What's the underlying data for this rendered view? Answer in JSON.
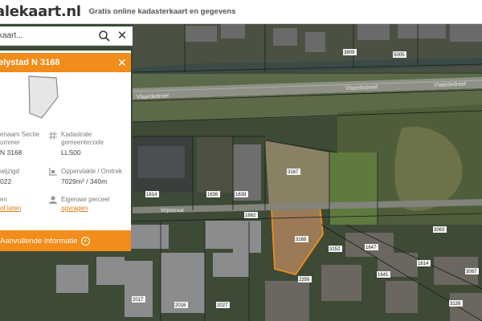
{
  "header": {
    "logo": "alekaart.nl",
    "tagline": "Gratis online kadasterkaart en gegevens"
  },
  "search": {
    "placeholder": "kaart..."
  },
  "panel": {
    "title": "elystad N 3168",
    "fields": {
      "section_label": "enaam Sectie\nummer",
      "section_value": "N 3168",
      "code_label": "Kadastrale\ngemeentecode",
      "code_value": "LLS00",
      "modified_label": "wijzigd",
      "modified_value": "022",
      "area_label": "Oppervlakte / Omtrek",
      "area_value": "7029m² / 340m",
      "owner_label": "Eigenaar perceel",
      "owner_link": "opvragen",
      "left_label": "en",
      "left_link": "of laten"
    },
    "more_button": "Aanvullende informatie"
  },
  "map": {
    "street_upper": "Vlaardedreef",
    "street_upper_right": "Vlaardedreef",
    "street_upper_left": "Vlaardedreef",
    "street_middle": "Wijdstraat",
    "parcel_labels": [
      "3167",
      "3168",
      "1636",
      "1638",
      "1614",
      "2017",
      "2016",
      "3809",
      "5005",
      "1682",
      "2356",
      "1647",
      "1614",
      "2027",
      "3152",
      "1641",
      "3063",
      "3087",
      "3126"
    ],
    "accent_color": "#f28c1a"
  }
}
